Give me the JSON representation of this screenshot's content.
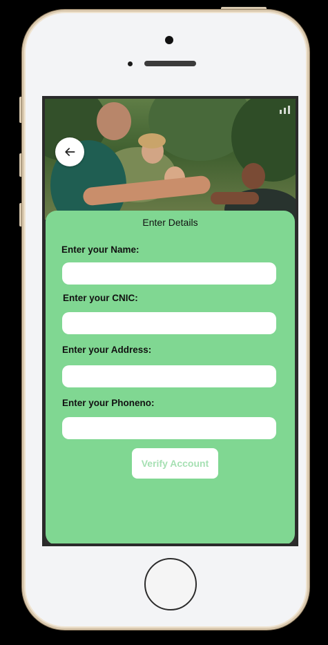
{
  "screen": {
    "title": "Enter Details",
    "back_icon": "arrow-left-icon",
    "header_image": "group-of-friends-photo"
  },
  "form": {
    "fields": [
      {
        "label": "Enter your Name:",
        "value": "",
        "placeholder": ""
      },
      {
        "label": "Enter your CNIC:",
        "value": "",
        "placeholder": ""
      },
      {
        "label": "Enter your Address:",
        "value": "",
        "placeholder": ""
      },
      {
        "label": "Enter your Phoneno:",
        "value": "",
        "placeholder": ""
      }
    ],
    "submit_label": "Verify Account"
  },
  "colors": {
    "card_background": "#80d792",
    "submit_text": "#a6e0b3",
    "input_background": "#ffffff"
  }
}
